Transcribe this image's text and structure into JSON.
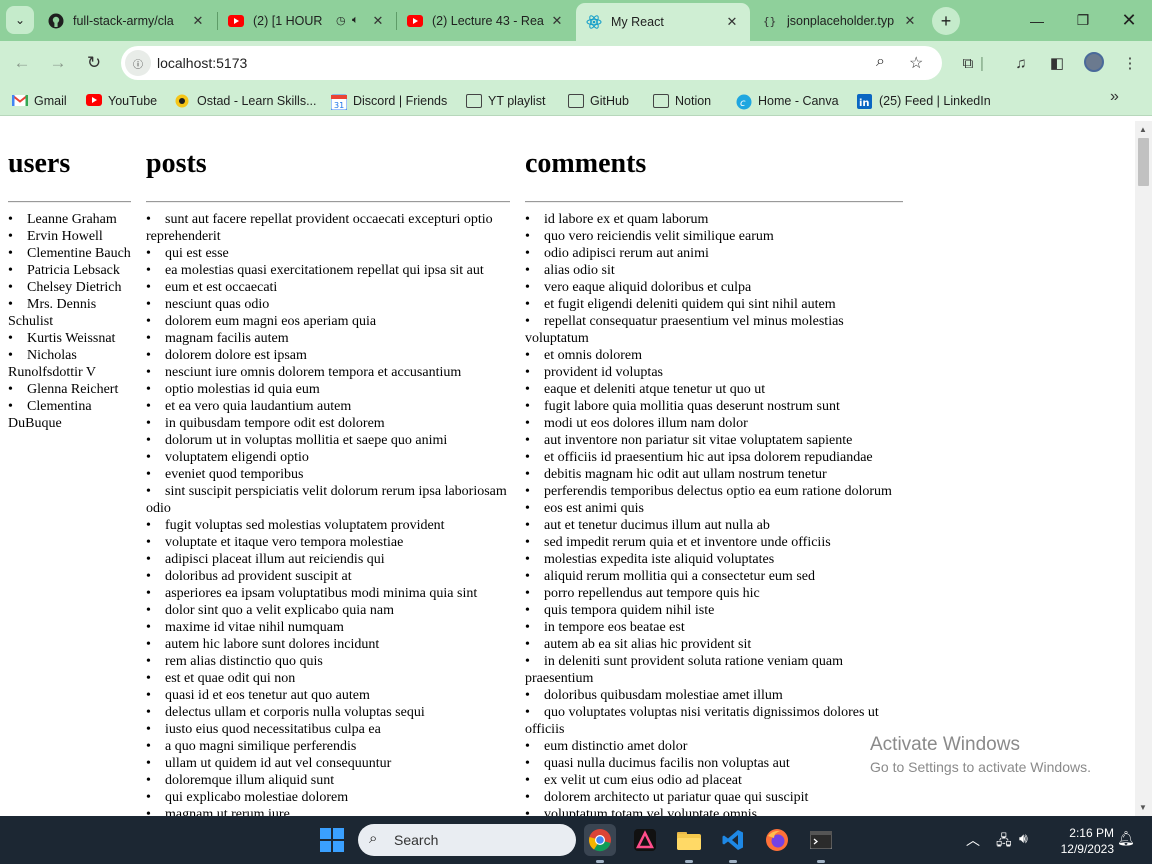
{
  "browser": {
    "tabs": [
      {
        "title": "full-stack-army/cla",
        "icon": "github-icon",
        "active": false
      },
      {
        "title": "(2) [1 HOUR",
        "icon": "youtube-icon",
        "active": false
      },
      {
        "title": "(2) Lecture 43 - Rea",
        "icon": "youtube-icon",
        "active": false
      },
      {
        "title": "My React",
        "icon": "react-icon",
        "active": true
      },
      {
        "title": "jsonplaceholder.typ",
        "icon": "jsonplaceholder-icon",
        "active": false
      }
    ],
    "url": "localhost:5173",
    "bookmarks": [
      {
        "label": "Gmail",
        "icon": "gmail-icon"
      },
      {
        "label": "YouTube",
        "icon": "youtube-icon"
      },
      {
        "label": "Ostad - Learn Skills...",
        "icon": "ostad-icon"
      },
      {
        "label": "Discord | Friends",
        "icon": "discord-icon"
      },
      {
        "label": "YT playlist",
        "icon": "folder-icon"
      },
      {
        "label": "GitHub",
        "icon": "folder-icon"
      },
      {
        "label": "Notion",
        "icon": "folder-icon"
      },
      {
        "label": "Home - Canva",
        "icon": "canva-icon"
      },
      {
        "label": "(25) Feed | LinkedIn",
        "icon": "linkedin-icon"
      }
    ],
    "calendar_badge": "31"
  },
  "page": {
    "users_heading": "users",
    "posts_heading": "posts",
    "comments_heading": "comments",
    "users": [
      "Leanne Graham",
      "Ervin Howell",
      "Clementine Bauch",
      "Patricia Lebsack",
      "Chelsey Dietrich",
      "Mrs. Dennis Schulist",
      "Kurtis Weissnat",
      "Nicholas Runolfsdottir V",
      "Glenna Reichert",
      "Clementina DuBuque"
    ],
    "posts": [
      "sunt aut facere repellat provident occaecati excepturi optio reprehenderit",
      "qui est esse",
      "ea molestias quasi exercitationem repellat qui ipsa sit aut",
      "eum et est occaecati",
      "nesciunt quas odio",
      "dolorem eum magni eos aperiam quia",
      "magnam facilis autem",
      "dolorem dolore est ipsam",
      "nesciunt iure omnis dolorem tempora et accusantium",
      "optio molestias id quia eum",
      "et ea vero quia laudantium autem",
      "in quibusdam tempore odit est dolorem",
      "dolorum ut in voluptas mollitia et saepe quo animi",
      "voluptatem eligendi optio",
      "eveniet quod temporibus",
      "sint suscipit perspiciatis velit dolorum rerum ipsa laboriosam odio",
      "fugit voluptas sed molestias voluptatem provident",
      "voluptate et itaque vero tempora molestiae",
      "adipisci placeat illum aut reiciendis qui",
      "doloribus ad provident suscipit at",
      "asperiores ea ipsam voluptatibus modi minima quia sint",
      "dolor sint quo a velit explicabo quia nam",
      "maxime id vitae nihil numquam",
      "autem hic labore sunt dolores incidunt",
      "rem alias distinctio quo quis",
      "est et quae odit qui non",
      "quasi id et eos tenetur aut quo autem",
      "delectus ullam et corporis nulla voluptas sequi",
      "iusto eius quod necessitatibus culpa ea",
      "a quo magni similique perferendis",
      "ullam ut quidem id aut vel consequuntur",
      "doloremque illum aliquid sunt",
      "qui explicabo molestiae dolorem",
      "magnam ut rerum iure"
    ],
    "comments": [
      "id labore ex et quam laborum",
      "quo vero reiciendis velit similique earum",
      "odio adipisci rerum aut animi",
      "alias odio sit",
      "vero eaque aliquid doloribus et culpa",
      "et fugit eligendi deleniti quidem qui sint nihil autem",
      "repellat consequatur praesentium vel minus molestias voluptatum",
      "et omnis dolorem",
      "provident id voluptas",
      "eaque et deleniti atque tenetur ut quo ut",
      "fugit labore quia mollitia quas deserunt nostrum sunt",
      "modi ut eos dolores illum nam dolor",
      "aut inventore non pariatur sit vitae voluptatem sapiente",
      "et officiis id praesentium hic aut ipsa dolorem repudiandae",
      "debitis magnam hic odit aut ullam nostrum tenetur",
      "perferendis temporibus delectus optio ea eum ratione dolorum",
      "eos est animi quis",
      "aut et tenetur ducimus illum aut nulla ab",
      "sed impedit rerum quia et et inventore unde officiis",
      "molestias expedita iste aliquid voluptates",
      "aliquid rerum mollitia qui a consectetur eum sed",
      "porro repellendus aut tempore quis hic",
      "quis tempora quidem nihil iste",
      "in tempore eos beatae est",
      "autem ab ea sit alias hic provident sit",
      "in deleniti sunt provident soluta ratione veniam quam praesentium",
      "doloribus quibusdam molestiae amet illum",
      "quo voluptates voluptas nisi veritatis dignissimos dolores ut officiis",
      "eum distinctio amet dolor",
      "quasi nulla ducimus facilis non voluptas aut",
      "ex velit ut cum eius odio ad placeat",
      "dolorem architecto ut pariatur quae qui suscipit",
      "voluptatum totam vel voluptate omnis"
    ]
  },
  "watermark": {
    "title": "Activate Windows",
    "subtitle": "Go to Settings to activate Windows."
  },
  "taskbar": {
    "search_label": "Search",
    "time": "2:16 PM",
    "date": "12/9/2023"
  }
}
